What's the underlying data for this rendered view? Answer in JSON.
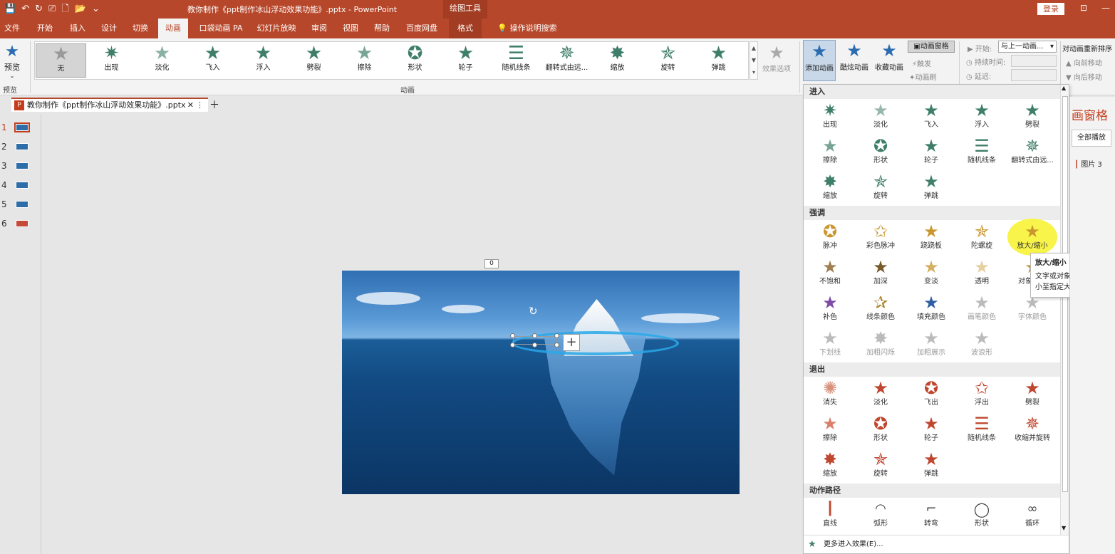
{
  "titlebar": {
    "doc_title": "教你制作《ppt制作冰山浮动效果功能》.pptx  -  PowerPoint",
    "tools_label": "绘图工具",
    "login_label": "登录"
  },
  "menu_tabs": [
    {
      "label": "文件"
    },
    {
      "label": "开始"
    },
    {
      "label": "插入"
    },
    {
      "label": "设计"
    },
    {
      "label": "切换"
    },
    {
      "label": "动画"
    },
    {
      "label": "口袋动画 PA"
    },
    {
      "label": "幻灯片放映"
    },
    {
      "label": "审阅"
    },
    {
      "label": "视图"
    },
    {
      "label": "帮助"
    },
    {
      "label": "百度网盘"
    },
    {
      "label": "格式"
    }
  ],
  "search_tell": "操作说明搜索",
  "ribbon": {
    "preview_label": "预览",
    "preview_group": "预览",
    "animation_group": "动画",
    "effect_options": "效果选项",
    "gallery": [
      {
        "label": "无"
      },
      {
        "label": "出现"
      },
      {
        "label": "淡化"
      },
      {
        "label": "飞入"
      },
      {
        "label": "浮入"
      },
      {
        "label": "劈裂"
      },
      {
        "label": "擦除"
      },
      {
        "label": "形状"
      },
      {
        "label": "轮子"
      },
      {
        "label": "随机线条"
      },
      {
        "label": "翻转式由远..."
      },
      {
        "label": "缩放"
      },
      {
        "label": "旋转"
      },
      {
        "label": "弹跳"
      }
    ],
    "add_animation": "添加动画",
    "cool_animation": "酷炫动画",
    "collect_animation": "收藏动画",
    "anim_pane_btn": "动画窗格",
    "trigger": "触发",
    "anim_brush": "动画刷",
    "start_label": "开始:",
    "start_value": "与上一动画...",
    "duration_label": "持续时间:",
    "delay_label": "延迟:",
    "reorder_label": "对动画重新排序",
    "move_earlier": "向前移动",
    "move_later": "向后移动"
  },
  "file_tab": {
    "label": "教你制作《ppt制作冰山浮动效果功能》.pptx",
    "badge": "P"
  },
  "slides": [
    {
      "num": "1"
    },
    {
      "num": "2"
    },
    {
      "num": "3"
    },
    {
      "num": "4"
    },
    {
      "num": "5"
    },
    {
      "num": "6"
    }
  ],
  "anim_tag": "0",
  "dropdown": {
    "entrance_title": "进入",
    "entrance": [
      {
        "label": "出现"
      },
      {
        "label": "淡化"
      },
      {
        "label": "飞入"
      },
      {
        "label": "浮入"
      },
      {
        "label": "劈裂"
      },
      {
        "label": "擦除"
      },
      {
        "label": "形状"
      },
      {
        "label": "轮子"
      },
      {
        "label": "随机线条"
      },
      {
        "label": "翻转式由远..."
      },
      {
        "label": "缩放"
      },
      {
        "label": "旋转"
      },
      {
        "label": "弹跳"
      }
    ],
    "emphasis_title": "强调",
    "emphasis": [
      {
        "label": "脉冲"
      },
      {
        "label": "彩色脉冲"
      },
      {
        "label": "跷跷板"
      },
      {
        "label": "陀螺旋"
      },
      {
        "label": "放大/缩小"
      },
      {
        "label": "不饱和"
      },
      {
        "label": "加深"
      },
      {
        "label": "变淡"
      },
      {
        "label": "透明"
      },
      {
        "label": "对象颜色"
      },
      {
        "label": "补色"
      },
      {
        "label": "线条颜色"
      },
      {
        "label": "填充颜色"
      },
      {
        "label": "画笔颜色"
      },
      {
        "label": "字体颜色"
      },
      {
        "label": "下划线"
      },
      {
        "label": "加粗闪烁"
      },
      {
        "label": "加粗展示"
      },
      {
        "label": "波浪形"
      }
    ],
    "exit_title": "退出",
    "exit": [
      {
        "label": "消失"
      },
      {
        "label": "淡化"
      },
      {
        "label": "飞出"
      },
      {
        "label": "浮出"
      },
      {
        "label": "劈裂"
      },
      {
        "label": "擦除"
      },
      {
        "label": "形状"
      },
      {
        "label": "轮子"
      },
      {
        "label": "随机线条"
      },
      {
        "label": "收缩并旋转"
      },
      {
        "label": "缩放"
      },
      {
        "label": "旋转"
      },
      {
        "label": "弹跳"
      }
    ],
    "motion_title": "动作路径",
    "motion": [
      {
        "label": "直线"
      },
      {
        "label": "弧形"
      },
      {
        "label": "转弯"
      },
      {
        "label": "形状"
      },
      {
        "label": "循环"
      }
    ],
    "more_effects": "更多进入效果(E)..."
  },
  "tooltip": {
    "title": "放大/缩小",
    "body": "文字或对象先增大再缩小至指定大小。"
  },
  "anim_pane": {
    "title": "画窗格",
    "play_all": "全部播放",
    "item": "图片 3"
  },
  "colors": {
    "accent": "#b7472a",
    "entrance": "#3f7e6a",
    "emphasis": "#c9962f",
    "exit": "#c0472f",
    "disabled": "#a8a8a8"
  }
}
